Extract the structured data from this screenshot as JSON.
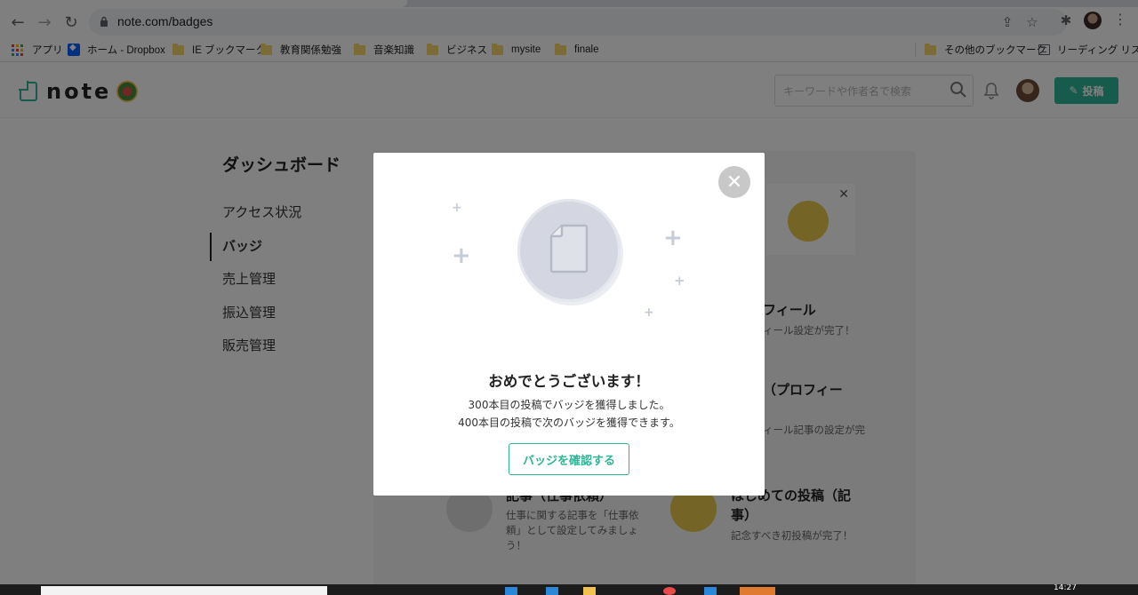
{
  "browser": {
    "url": "note.com/badges",
    "bookmarks": [
      {
        "label": "アプリ",
        "icon": "apps-grid-icon"
      },
      {
        "label": "ホーム - Dropbox",
        "icon": "dropbox-icon"
      },
      {
        "label": "IE ブックマーク",
        "icon": "folder-icon"
      },
      {
        "label": "教育関係勉強",
        "icon": "folder-icon"
      },
      {
        "label": "音楽知識",
        "icon": "folder-icon"
      },
      {
        "label": "ビジネス",
        "icon": "folder-icon"
      },
      {
        "label": "mysite",
        "icon": "folder-icon"
      },
      {
        "label": "finale",
        "icon": "folder-icon"
      }
    ],
    "other_bookmarks": "その他のブックマーク",
    "reading_list": "リーディング リスト"
  },
  "header": {
    "logo_text": "note",
    "search_placeholder": "キーワードや作者名で検索",
    "post_label": "投稿",
    "accent_color": "#2cb696"
  },
  "sidebar": {
    "title": "ダッシュボード",
    "items": [
      {
        "label": "アクセス状況",
        "active": false
      },
      {
        "label": "バッジ",
        "active": true
      },
      {
        "label": "売上管理",
        "active": false
      },
      {
        "label": "振込管理",
        "active": false
      },
      {
        "label": "販売管理",
        "active": false
      }
    ]
  },
  "background": {
    "profile_title": "フィール",
    "profile_sub": "ィール設定が完了！",
    "profile_article_title": "（プロフィー",
    "profile_article_sub": "ィール記事の設定が完",
    "work_title": "記事（仕事依頼）",
    "work_desc": "仕事に関する記事を「仕事依頼」として設定してみましょう！",
    "first_post_title_1": "はじめての投稿（記",
    "first_post_title_2": "事）",
    "first_post_sub": "記念すべき初投稿が完了！"
  },
  "modal": {
    "title": "おめでとうございます！",
    "line1": "300本目の投稿でバッジを獲得しました。",
    "line2": "400本目の投稿で次のバッジを獲得できます。",
    "button": "バッジを確認する"
  },
  "taskbar": {
    "time": "14:27"
  }
}
